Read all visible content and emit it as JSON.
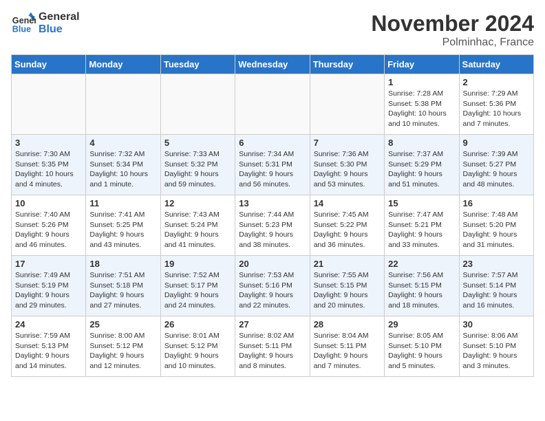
{
  "header": {
    "logo_line1": "General",
    "logo_line2": "Blue",
    "month": "November 2024",
    "location": "Polminhac, France"
  },
  "weekdays": [
    "Sunday",
    "Monday",
    "Tuesday",
    "Wednesday",
    "Thursday",
    "Friday",
    "Saturday"
  ],
  "weeks": [
    [
      {
        "day": "",
        "info": ""
      },
      {
        "day": "",
        "info": ""
      },
      {
        "day": "",
        "info": ""
      },
      {
        "day": "",
        "info": ""
      },
      {
        "day": "",
        "info": ""
      },
      {
        "day": "1",
        "info": "Sunrise: 7:28 AM\nSunset: 5:38 PM\nDaylight: 10 hours and 10 minutes."
      },
      {
        "day": "2",
        "info": "Sunrise: 7:29 AM\nSunset: 5:36 PM\nDaylight: 10 hours and 7 minutes."
      }
    ],
    [
      {
        "day": "3",
        "info": "Sunrise: 7:30 AM\nSunset: 5:35 PM\nDaylight: 10 hours and 4 minutes."
      },
      {
        "day": "4",
        "info": "Sunrise: 7:32 AM\nSunset: 5:34 PM\nDaylight: 10 hours and 1 minute."
      },
      {
        "day": "5",
        "info": "Sunrise: 7:33 AM\nSunset: 5:32 PM\nDaylight: 9 hours and 59 minutes."
      },
      {
        "day": "6",
        "info": "Sunrise: 7:34 AM\nSunset: 5:31 PM\nDaylight: 9 hours and 56 minutes."
      },
      {
        "day": "7",
        "info": "Sunrise: 7:36 AM\nSunset: 5:30 PM\nDaylight: 9 hours and 53 minutes."
      },
      {
        "day": "8",
        "info": "Sunrise: 7:37 AM\nSunset: 5:29 PM\nDaylight: 9 hours and 51 minutes."
      },
      {
        "day": "9",
        "info": "Sunrise: 7:39 AM\nSunset: 5:27 PM\nDaylight: 9 hours and 48 minutes."
      }
    ],
    [
      {
        "day": "10",
        "info": "Sunrise: 7:40 AM\nSunset: 5:26 PM\nDaylight: 9 hours and 46 minutes."
      },
      {
        "day": "11",
        "info": "Sunrise: 7:41 AM\nSunset: 5:25 PM\nDaylight: 9 hours and 43 minutes."
      },
      {
        "day": "12",
        "info": "Sunrise: 7:43 AM\nSunset: 5:24 PM\nDaylight: 9 hours and 41 minutes."
      },
      {
        "day": "13",
        "info": "Sunrise: 7:44 AM\nSunset: 5:23 PM\nDaylight: 9 hours and 38 minutes."
      },
      {
        "day": "14",
        "info": "Sunrise: 7:45 AM\nSunset: 5:22 PM\nDaylight: 9 hours and 36 minutes."
      },
      {
        "day": "15",
        "info": "Sunrise: 7:47 AM\nSunset: 5:21 PM\nDaylight: 9 hours and 33 minutes."
      },
      {
        "day": "16",
        "info": "Sunrise: 7:48 AM\nSunset: 5:20 PM\nDaylight: 9 hours and 31 minutes."
      }
    ],
    [
      {
        "day": "17",
        "info": "Sunrise: 7:49 AM\nSunset: 5:19 PM\nDaylight: 9 hours and 29 minutes."
      },
      {
        "day": "18",
        "info": "Sunrise: 7:51 AM\nSunset: 5:18 PM\nDaylight: 9 hours and 27 minutes."
      },
      {
        "day": "19",
        "info": "Sunrise: 7:52 AM\nSunset: 5:17 PM\nDaylight: 9 hours and 24 minutes."
      },
      {
        "day": "20",
        "info": "Sunrise: 7:53 AM\nSunset: 5:16 PM\nDaylight: 9 hours and 22 minutes."
      },
      {
        "day": "21",
        "info": "Sunrise: 7:55 AM\nSunset: 5:15 PM\nDaylight: 9 hours and 20 minutes."
      },
      {
        "day": "22",
        "info": "Sunrise: 7:56 AM\nSunset: 5:15 PM\nDaylight: 9 hours and 18 minutes."
      },
      {
        "day": "23",
        "info": "Sunrise: 7:57 AM\nSunset: 5:14 PM\nDaylight: 9 hours and 16 minutes."
      }
    ],
    [
      {
        "day": "24",
        "info": "Sunrise: 7:59 AM\nSunset: 5:13 PM\nDaylight: 9 hours and 14 minutes."
      },
      {
        "day": "25",
        "info": "Sunrise: 8:00 AM\nSunset: 5:12 PM\nDaylight: 9 hours and 12 minutes."
      },
      {
        "day": "26",
        "info": "Sunrise: 8:01 AM\nSunset: 5:12 PM\nDaylight: 9 hours and 10 minutes."
      },
      {
        "day": "27",
        "info": "Sunrise: 8:02 AM\nSunset: 5:11 PM\nDaylight: 9 hours and 8 minutes."
      },
      {
        "day": "28",
        "info": "Sunrise: 8:04 AM\nSunset: 5:11 PM\nDaylight: 9 hours and 7 minutes."
      },
      {
        "day": "29",
        "info": "Sunrise: 8:05 AM\nSunset: 5:10 PM\nDaylight: 9 hours and 5 minutes."
      },
      {
        "day": "30",
        "info": "Sunrise: 8:06 AM\nSunset: 5:10 PM\nDaylight: 9 hours and 3 minutes."
      }
    ]
  ]
}
